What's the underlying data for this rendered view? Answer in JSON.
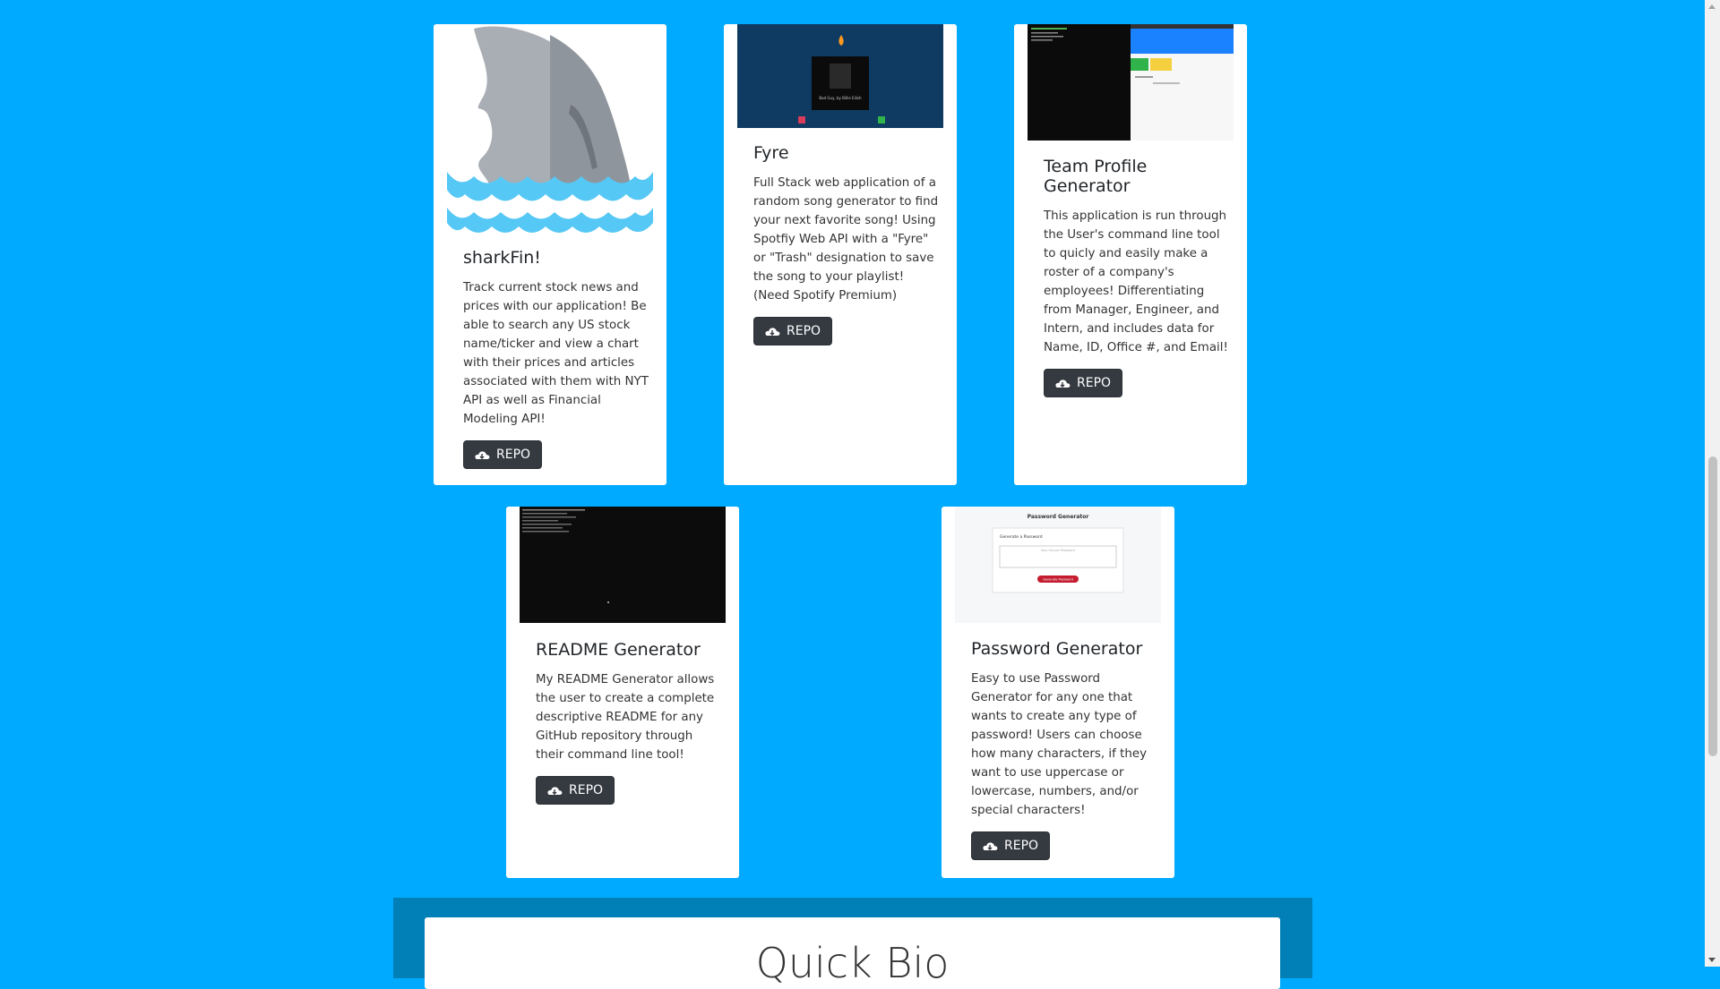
{
  "projects": [
    {
      "title": "sharkFin!",
      "description": "Track current stock news and prices with our application! Be able to search any US stock name/ticker and view a chart with their prices and articles associated with them with NYT API as well as Financial Modeling API!",
      "button_label": "REPO",
      "thumbnail": "shark-fin-icon"
    },
    {
      "title": "Fyre",
      "description": "Full Stack web application of a random song generator to find your next favorite song! Using Spotfiy Web API with a \"Fyre\" or \"Trash\" designation to save the song to your playlist! (Need Spotify Premium)",
      "button_label": "REPO",
      "thumbnail": "fyre-app-screenshot",
      "thumb_caption": "Bad Guy, by Billie Eilish"
    },
    {
      "title": "Team Profile Generator",
      "description": "This application is run through the User's command line tool to quicly and easily make a roster of a company's employees! Differentiating from Manager, Engineer, and Intern, and includes data for Name, ID, Office #, and Email!",
      "button_label": "REPO",
      "thumbnail": "team-profile-screenshot"
    },
    {
      "title": "README Generator",
      "description": "My README Generator allows the user to create a complete descriptive README for any GitHub repository through their command line tool!",
      "button_label": "REPO",
      "thumbnail": "terminal-screenshot"
    },
    {
      "title": "Password Generator",
      "description": "Easy to use Password Generator for any one that wants to create any type of password! Users can choose how many characters, if they want to use uppercase or lowercase, numbers, and/or special characters!",
      "button_label": "REPO",
      "thumbnail": "password-generator-screenshot",
      "thumb_title": "Password Generator",
      "thumb_subtitle": "Generate a Password",
      "thumb_placeholder": "Your Secure Password",
      "thumb_button": "Generate Password"
    }
  ],
  "bio": {
    "heading": "Quick Bio"
  },
  "colors": {
    "background": "#00aaff",
    "bio_band": "#0080b7",
    "button": "#343a40"
  }
}
